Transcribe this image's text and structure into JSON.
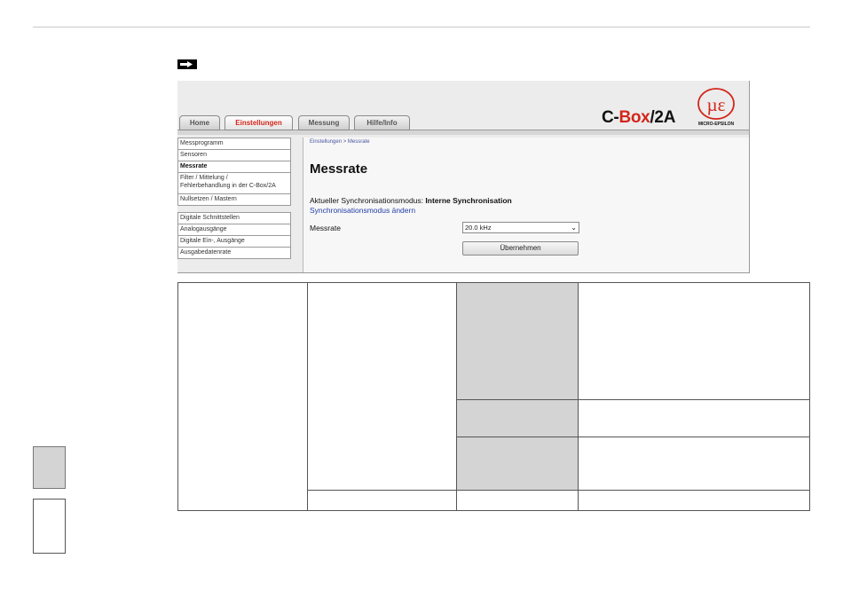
{
  "tabs": [
    {
      "label": "Home",
      "active": false
    },
    {
      "label": "Einstellungen",
      "active": true
    },
    {
      "label": "Messung",
      "active": false
    },
    {
      "label": "Hilfe/Info",
      "active": false
    }
  ],
  "brand": {
    "part1": "C-",
    "part2": "Box",
    "part3": "/2A",
    "logo_text": "MICRO-EPSILON",
    "logo_glyph": "µɛ"
  },
  "sidebar": {
    "group1": [
      "Messprogramm",
      "Sensoren",
      "Messrate"
    ],
    "filter_line1": "Filter / Mittelung /",
    "filter_line2": "Fehlerbehandlung in der C-Box/2A",
    "group1b": [
      "Nullsetzen / Mastern"
    ],
    "group2": [
      "Digitale Schnittstellen",
      "Analogausgänge",
      "Digitale Ein-, Ausgänge",
      "Ausgabedatenrate"
    ]
  },
  "content": {
    "breadcrumb": "Einstellungen > Messrate",
    "title": "Messrate",
    "sync_label": "Aktueller Synchronisationsmodus: ",
    "sync_value": "Interne Synchronisation",
    "sync_link": "Synchronisationsmodus ändern",
    "rate_label": "Messrate",
    "rate_value": "20.0 kHz",
    "apply_label": "Übernehmen"
  },
  "colors": {
    "accent": "#d3261b",
    "link": "#2540a8",
    "table_grey": "#d4d4d4"
  }
}
